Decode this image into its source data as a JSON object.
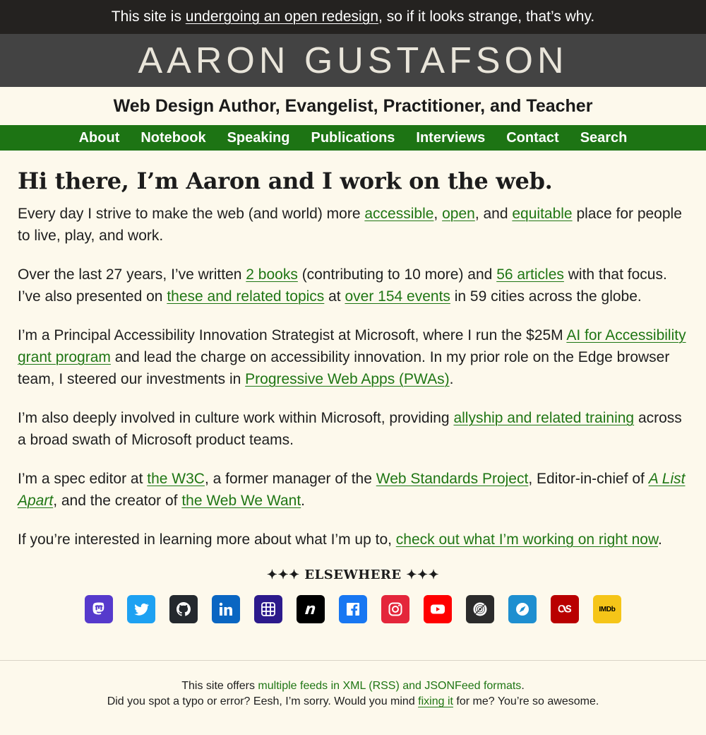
{
  "banner": {
    "pre": "This site is ",
    "link": "undergoing an open redesign",
    "post": ", so if it looks strange, that’s why."
  },
  "site_title": "AARON GUSTAFSON",
  "tagline": "Web Design Author, Evangelist, Practitioner, and Teacher",
  "nav": {
    "items": [
      {
        "label": "About"
      },
      {
        "label": "Notebook"
      },
      {
        "label": "Speaking"
      },
      {
        "label": "Publications"
      },
      {
        "label": "Interviews"
      },
      {
        "label": "Contact"
      },
      {
        "label": "Search"
      }
    ]
  },
  "main": {
    "heading": "Hi there, I’m Aaron and I work on the web.",
    "p1": {
      "t1": "Every day I strive to make the web (and world) more ",
      "l1": "accessible",
      "t2": ", ",
      "l2": "open",
      "t3": ", and ",
      "l3": "equitable",
      "t4": " place for people to live, play, and work."
    },
    "p2": {
      "t1": "Over the last 27 years, I’ve written ",
      "l1": "2 books",
      "t2": " (contributing to 10 more) and ",
      "l2": "56 articles",
      "t3": " with that focus. I’ve also presented on ",
      "l3": "these and related topics",
      "t4": " at ",
      "l4": "over 154 events",
      "t5": " in 59 cities across the globe."
    },
    "p3": {
      "t1": "I’m a Principal Accessibility Innovation Strategist at Microsoft, where I run the $25M ",
      "l1": "AI for Accessibility grant program",
      "t2": " and lead the charge on accessibility innovation. In my prior role on the Edge browser team, I steered our investments in ",
      "l2": "Progressive Web Apps (PWAs)",
      "t3": "."
    },
    "p4": {
      "t1": "I’m also deeply involved in culture work within Microsoft, providing ",
      "l1": "allyship and related training",
      "t2": " across a broad swath of Microsoft product teams."
    },
    "p5": {
      "t1": "I’m a spec editor at ",
      "l1": "the W3C",
      "t2": ", a former manager of the ",
      "l2": "Web Standards Project",
      "t3": ", Editor-in-chief of ",
      "l3": "A List Apart",
      "t4": ", and the creator of ",
      "l4": "the Web We Want",
      "t5": "."
    },
    "p6": {
      "t1": "If you’re interested in learning more about what I’m up to, ",
      "l1": "check out what I’m working on right now",
      "t2": "."
    }
  },
  "elsewhere": {
    "heading": "✦✦✦ ELSEWHERE ✦✦✦",
    "social": [
      {
        "icon": "mastodon-icon",
        "color": "#563acc"
      },
      {
        "icon": "twitter-icon",
        "color": "#1da1f2"
      },
      {
        "icon": "github-icon",
        "color": "#24292e"
      },
      {
        "icon": "linkedin-icon",
        "color": "#0a66c2"
      },
      {
        "icon": "codepen-grid-icon",
        "color": "#2c1a8c"
      },
      {
        "icon": "notist-icon",
        "color": "#000000"
      },
      {
        "icon": "facebook-icon",
        "color": "#1877f2"
      },
      {
        "icon": "instagram-icon",
        "color": "#e4263b"
      },
      {
        "icon": "youtube-icon",
        "color": "#ff0000"
      },
      {
        "icon": "vinyl-record-icon",
        "color": "#2b2b2b"
      },
      {
        "icon": "compass-icon",
        "color": "#1e8fd0"
      },
      {
        "icon": "lastfm-icon",
        "color": "#b90000"
      },
      {
        "icon": "imdb-icon",
        "color": "#f5c518",
        "label": "IMDb"
      }
    ]
  },
  "footer": {
    "line1": {
      "t1": "This site offers ",
      "l1": "multiple feeds in XML (RSS) and JSONFeed formats",
      "t2": "."
    },
    "line2": {
      "t1": "Did you spot a typo or error? Eesh, I’m sorry. Would you mind ",
      "l1": "fixing it",
      "t2": " for me? You’re so awesome."
    }
  },
  "colors": {
    "background": "#fdf9ec",
    "banner": "#242220",
    "masthead": "#434343",
    "nav": "#1d7414",
    "link": "#1f7614"
  }
}
